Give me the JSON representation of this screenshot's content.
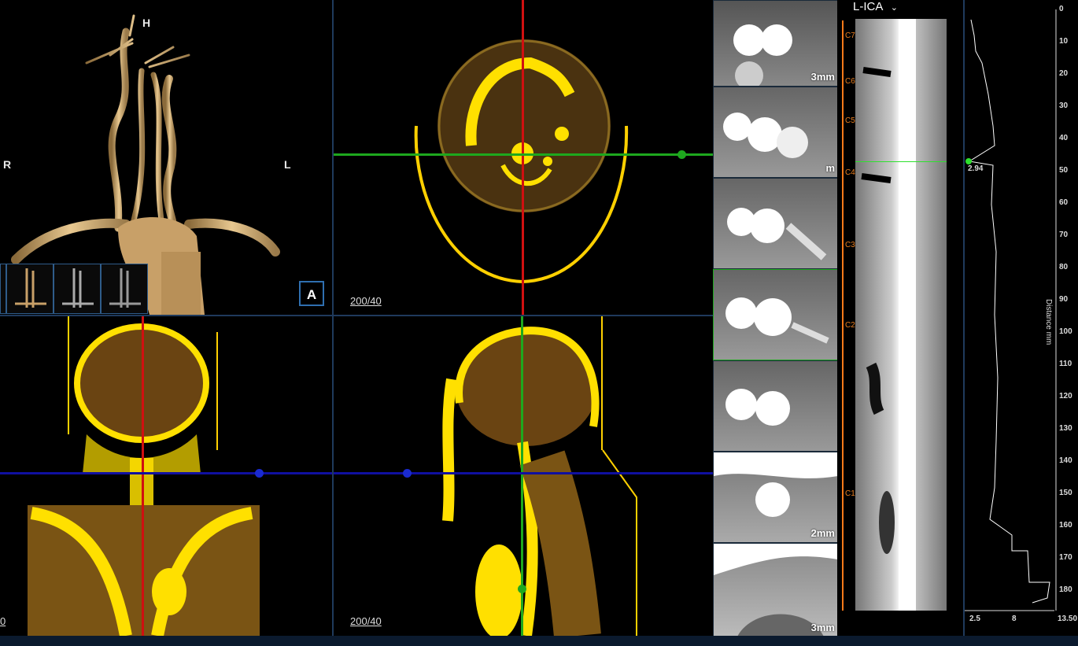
{
  "viewports": {
    "vr": {
      "top": "H",
      "left": "R",
      "right": "L",
      "orientation_button": "A"
    },
    "axial": {
      "window_level": "200/40"
    },
    "coronal": {
      "window_level": "0"
    },
    "sagittal": {
      "window_level": "200/40"
    }
  },
  "vessel": {
    "name": "L-ICA",
    "dropdown_icon": "chevron-down-icon"
  },
  "cross_sections": [
    {
      "label": "3mm"
    },
    {
      "label": "m"
    },
    {
      "label": ""
    },
    {
      "label": ""
    },
    {
      "label": ""
    },
    {
      "label": "2mm"
    },
    {
      "label": "3mm"
    }
  ],
  "vertebrae": [
    "C7",
    "C6",
    "C5",
    "C4",
    "C3",
    "C2",
    "C1"
  ],
  "plot": {
    "marker_value": "2.94",
    "x_ticks": [
      "2.5",
      "8",
      "13.50"
    ],
    "y_ticks": [
      "0",
      "10",
      "20",
      "30",
      "40",
      "50",
      "60",
      "70",
      "80",
      "90",
      "100",
      "110",
      "120",
      "130",
      "140",
      "150",
      "160",
      "170",
      "180"
    ],
    "axis_label": "Distance mm"
  },
  "colors": {
    "accent": "#ff7a1a",
    "green": "#1ea81e",
    "red": "#d01010",
    "blue": "#1010a0",
    "divider": "#1f3a5c"
  }
}
